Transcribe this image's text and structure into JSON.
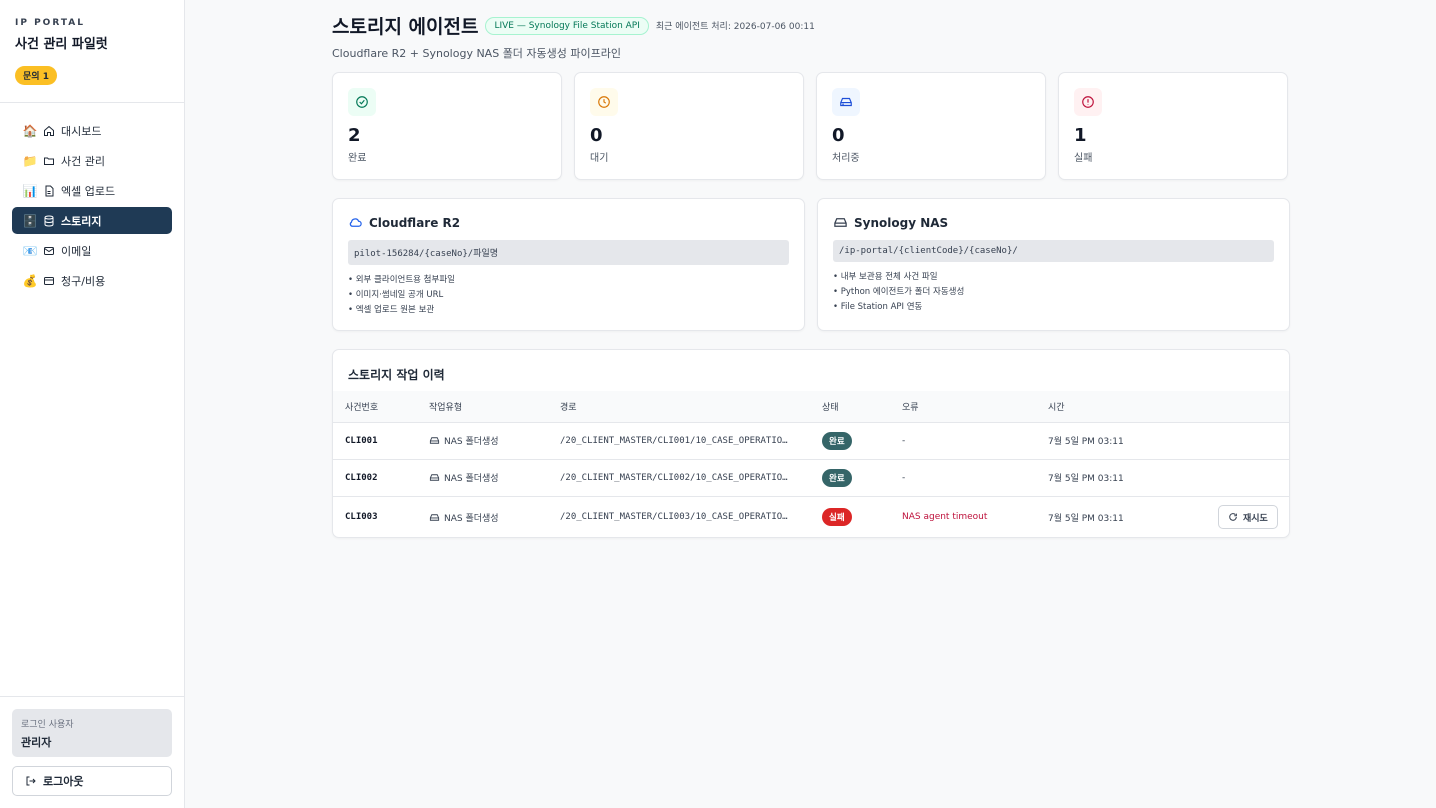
{
  "sidebar": {
    "kicker": "IP PORTAL",
    "title": "사건 관리 파일럿",
    "badge": "문의 1",
    "items": [
      {
        "emoji": "🏠",
        "label": "대시보드"
      },
      {
        "emoji": "📁",
        "label": "사건 관리"
      },
      {
        "emoji": "📊",
        "label": "엑셀 업로드"
      },
      {
        "emoji": "🗄️",
        "label": "스토리지"
      },
      {
        "emoji": "📧",
        "label": "이메일"
      },
      {
        "emoji": "💰",
        "label": "청구/비용"
      }
    ],
    "user_label": "로그인 사용자",
    "user_name": "관리자",
    "logout": "로그아웃"
  },
  "header": {
    "title": "스토리지 에이전트",
    "live_badge": "LIVE — Synology File Station API",
    "meta": "최근 에이전트 처리: 2026-07-06 00:11",
    "subtitle": "Cloudflare R2 + Synology NAS 폴더 자동생성 파이프라인"
  },
  "stats": [
    {
      "value": "2",
      "label": "완료",
      "icon": "check-circle-icon",
      "color": "#047857",
      "bg": "#ecfdf5"
    },
    {
      "value": "0",
      "label": "대기",
      "icon": "clock-icon",
      "color": "#d97706",
      "bg": "#fffbeb"
    },
    {
      "value": "0",
      "label": "처리중",
      "icon": "hard-drive-icon",
      "color": "#1d4ed8",
      "bg": "#eff6ff"
    },
    {
      "value": "1",
      "label": "실패",
      "icon": "alert-circle-icon",
      "color": "#be123c",
      "bg": "#fff1f2"
    }
  ],
  "r2": {
    "title": "Cloudflare R2",
    "path": "pilot-156284/{caseNo}/파일명",
    "bullets": [
      "외부 클라이언트용 첨부파일",
      "이미지·썸네일 공개 URL",
      "엑셀 업로드 원본 보관"
    ]
  },
  "nas": {
    "title": "Synology NAS",
    "path": "/ip-portal/{clientCode}/{caseNo}/",
    "bullets": [
      "내부 보관용 전체 사건 파일",
      "Python 에이전트가 폴더 자동생성",
      "File Station API 연동"
    ]
  },
  "log": {
    "title": "스토리지 작업 이력",
    "columns": [
      "사건번호",
      "작업유형",
      "경로",
      "상태",
      "오류",
      "시간"
    ],
    "rows": [
      {
        "case": "CLI001",
        "type": "NAS 폴더생성",
        "path": "/20_CLIENT_MASTER/CLI001/10_CASE_OPERATIO…",
        "status": "완료",
        "error": "-",
        "time": "7월 5일 PM 03:11"
      },
      {
        "case": "CLI002",
        "type": "NAS 폴더생성",
        "path": "/20_CLIENT_MASTER/CLI002/10_CASE_OPERATIO…",
        "status": "완료",
        "error": "-",
        "time": "7월 5일 PM 03:11"
      },
      {
        "case": "CLI003",
        "type": "NAS 폴더생성",
        "path": "/20_CLIENT_MASTER/CLI003/10_CASE_OPERATIO…",
        "status": "실패",
        "error": "NAS agent timeout",
        "time": "7월 5일 PM 03:11",
        "action": "재시도"
      }
    ]
  }
}
